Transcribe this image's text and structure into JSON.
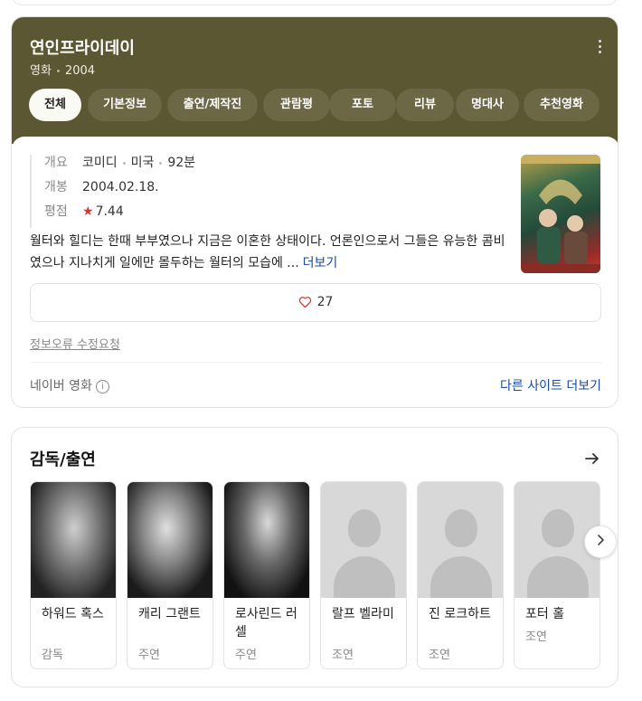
{
  "movie": {
    "title": "연인프라이데이",
    "category": "영화",
    "year": "2004"
  },
  "tabs": [
    {
      "label": "전체",
      "active": true
    },
    {
      "label": "기본정보"
    },
    {
      "label": "출연/제작진"
    },
    {
      "label": "관람평"
    },
    {
      "label": "포토"
    },
    {
      "label": "리뷰"
    },
    {
      "label": "명대사"
    },
    {
      "label": "추천영화"
    }
  ],
  "info": {
    "overview_key": "개요",
    "genre": "코미디",
    "country": "미국",
    "runtime": "92분",
    "release_key": "개봉",
    "release_date": "2004.02.18.",
    "rating_key": "평점",
    "rating_star": "★",
    "rating": "7.44"
  },
  "summary": {
    "text": "월터와 힐디는 한때 부부였으나 지금은 이혼한 상태이다. 언론인으로서 그들은 유능한 콤비였으나 지나치게 일에만 몰두하는 월터의 모습에 ...",
    "more_label": "더보기"
  },
  "like": {
    "count": "27",
    "icon": "heart-icon"
  },
  "report_label": "정보오류 수정요청",
  "source_label": "네이버 영화",
  "other_sites_label": "다른 사이트 더보기",
  "cast": {
    "title": "감독/출연",
    "people": [
      {
        "name": "하워드 혹스",
        "role": "감독"
      },
      {
        "name": "캐리 그랜트",
        "role": "주연"
      },
      {
        "name": "로사린드 러셀",
        "role": "주연"
      },
      {
        "name": "랄프 벨라미",
        "role": "조연"
      },
      {
        "name": "진 로크하트",
        "role": "조연"
      },
      {
        "name": "포터 홀",
        "role": "조연"
      }
    ]
  },
  "colors": {
    "hero_bg": "#5c5733",
    "link": "#1a4aa0",
    "star": "#e0322c"
  }
}
